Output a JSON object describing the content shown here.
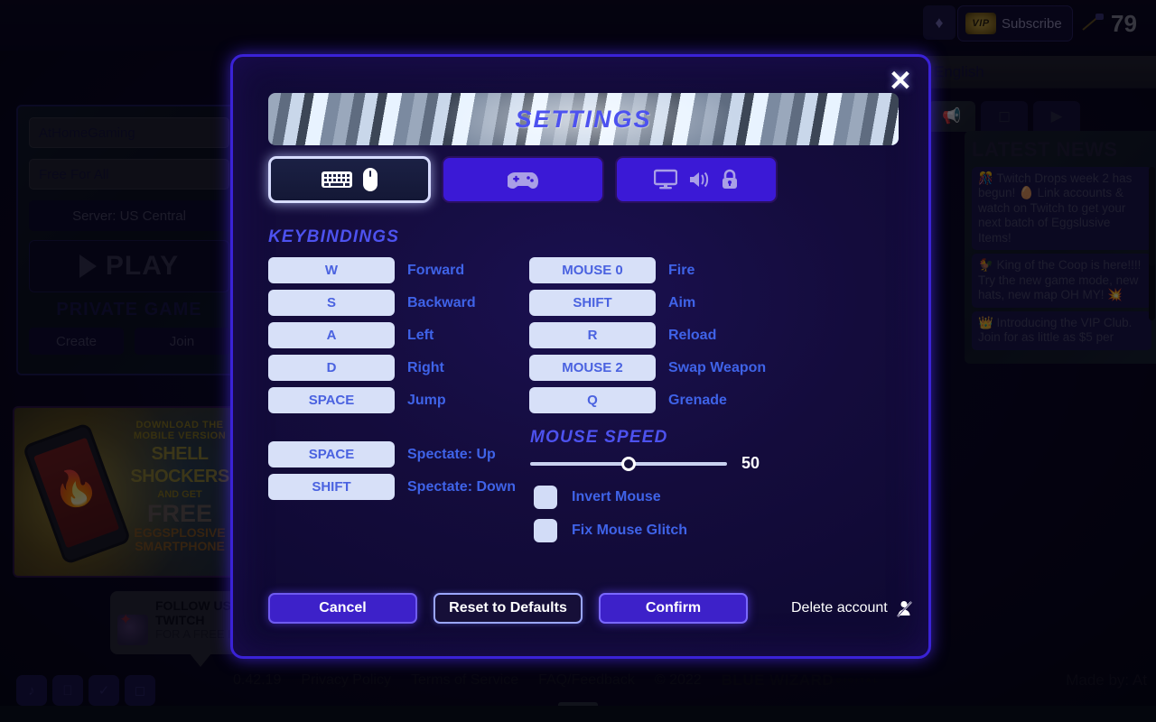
{
  "topbar": {
    "gem_icon": "gem-icon",
    "vip_badge": "VIP",
    "subscribe_label": "Subscribe",
    "currency_icon": "pickaxe-icon",
    "currency_value": "79"
  },
  "language_bar": {
    "value": "English"
  },
  "lobby": {
    "username": "AtHomeGaming",
    "gamemode": "Free For All",
    "server": "Server: US Central",
    "play_label": "PLAY",
    "private_header": "PRIVATE GAME",
    "create_label": "Create",
    "join_label": "Join"
  },
  "promo": {
    "line1": "DOWNLOAD THE",
    "line2": "MOBILE VERSION",
    "line3": "SHELL",
    "line4": "SHOCKERS",
    "line5": "AND GET",
    "line6": "FREE",
    "line7": "EGGSPLOSIVE",
    "line8": "SMARTPHONE"
  },
  "bubble": {
    "line1": "FOLLOW US ON",
    "line2": "TWITCH",
    "line3": "FOR A FREE HAT"
  },
  "social": {
    "tabs": [
      {
        "name": "news-tab",
        "icon": "megaphone-icon"
      },
      {
        "name": "twitch-tab",
        "icon": "twitch-icon"
      },
      {
        "name": "youtube-tab",
        "icon": "youtube-icon"
      }
    ]
  },
  "news": {
    "title": "LATEST NEWS",
    "items": [
      "🎊 Twitch Drops week 2 has begun! 🥚 Link accounts & watch on Twitch to get your next batch of Eggslusive Items!",
      "🐓 King of the Coop is here!!!! Try the new game mode, new hats, new map OH MY! 💥",
      "👑 Introducing the VIP Club. Join for as little as $5 per"
    ]
  },
  "footer": {
    "version": "0.42.19",
    "links": [
      "Privacy Policy",
      "Terms of Service",
      "FAQ/Feedback"
    ],
    "copyright": "© 2022",
    "studio": "BLUE WIZARD",
    "studio_sub": "DIGITAL",
    "made_by": "Made by: At",
    "app_icons": [
      "tiktok-icon",
      "apple-icon",
      "check-icon",
      "twitch-icon"
    ]
  },
  "modal": {
    "title": "SETTINGS",
    "close_icon": "close-icon",
    "tabs": [
      {
        "name": "tab-keyboard-mouse",
        "icons": [
          "keyboard-icon",
          "mouse-icon"
        ],
        "active": true
      },
      {
        "name": "tab-gamepad",
        "icons": [
          "gamepad-icon"
        ],
        "active": false
      },
      {
        "name": "tab-video-audio-privacy",
        "icons": [
          "monitor-icon",
          "speaker-icon",
          "lock-icon"
        ],
        "active": false
      }
    ],
    "keybindings_header": "KEYBINDINGS",
    "bindings_left": [
      {
        "key": "W",
        "action": "Forward"
      },
      {
        "key": "S",
        "action": "Backward"
      },
      {
        "key": "A",
        "action": "Left"
      },
      {
        "key": "D",
        "action": "Right"
      },
      {
        "key": "SPACE",
        "action": "Jump"
      }
    ],
    "bindings_right": [
      {
        "key": "MOUSE 0",
        "action": "Fire"
      },
      {
        "key": "SHIFT",
        "action": "Aim"
      },
      {
        "key": "R",
        "action": "Reload"
      },
      {
        "key": "MOUSE 2",
        "action": "Swap Weapon"
      },
      {
        "key": "Q",
        "action": "Grenade"
      }
    ],
    "bindings_spectate": [
      {
        "key": "SPACE",
        "action": "Spectate: Up"
      },
      {
        "key": "SHIFT",
        "action": "Spectate: Down"
      }
    ],
    "mouse_speed_header": "MOUSE SPEED",
    "mouse_speed_value": "50",
    "mouse_speed_percent": 50,
    "checkboxes": [
      {
        "label": "Invert Mouse",
        "checked": false
      },
      {
        "label": "Fix Mouse Glitch",
        "checked": false
      }
    ],
    "cancel_label": "Cancel",
    "reset_label": "Reset to Defaults",
    "confirm_label": "Confirm",
    "delete_account_label": "Delete account",
    "delete_account_icon": "user-remove-icon"
  },
  "colors": {
    "accent_blue": "#3f63e8",
    "title_blue": "#4d52ef",
    "modal_border": "#3a22d6",
    "purple_button": "#3d21c9",
    "keycap": "#d7e0f8"
  }
}
